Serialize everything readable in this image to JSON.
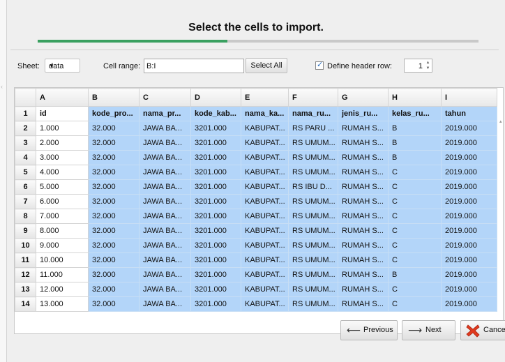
{
  "dialog": {
    "title": "Select the cells to import.",
    "progress": 0.43
  },
  "controls": {
    "sheet_label": "Sheet:",
    "sheet_value": "data",
    "range_label": "Cell range:",
    "range_value": "B:I",
    "select_all_label": "Select All",
    "define_header_label": "Define header row:",
    "define_header_checked": true,
    "header_row_value": "1"
  },
  "grid": {
    "columns": [
      "A",
      "B",
      "C",
      "D",
      "E",
      "F",
      "G",
      "H",
      "I"
    ],
    "rows": [
      {
        "num": "1",
        "cells": [
          "id",
          "kode_pro...",
          "nama_pr...",
          "kode_kab...",
          "nama_ka...",
          "nama_ru...",
          "jenis_ru...",
          "kelas_ru...",
          "tahun"
        ]
      },
      {
        "num": "2",
        "cells": [
          "1.000",
          "32.000",
          "JAWA BA...",
          "3201.000",
          "KABUPAT...",
          "RS PARU ...",
          "RUMAH S...",
          "B",
          "2019.000"
        ]
      },
      {
        "num": "3",
        "cells": [
          "2.000",
          "32.000",
          "JAWA BA...",
          "3201.000",
          "KABUPAT...",
          "RS UMUM...",
          "RUMAH S...",
          "B",
          "2019.000"
        ]
      },
      {
        "num": "4",
        "cells": [
          "3.000",
          "32.000",
          "JAWA BA...",
          "3201.000",
          "KABUPAT...",
          "RS UMUM...",
          "RUMAH S...",
          "B",
          "2019.000"
        ]
      },
      {
        "num": "5",
        "cells": [
          "4.000",
          "32.000",
          "JAWA BA...",
          "3201.000",
          "KABUPAT...",
          "RS UMUM...",
          "RUMAH S...",
          "C",
          "2019.000"
        ]
      },
      {
        "num": "6",
        "cells": [
          "5.000",
          "32.000",
          "JAWA BA...",
          "3201.000",
          "KABUPAT...",
          "RS IBU D...",
          "RUMAH S...",
          "C",
          "2019.000"
        ]
      },
      {
        "num": "7",
        "cells": [
          "6.000",
          "32.000",
          "JAWA BA...",
          "3201.000",
          "KABUPAT...",
          "RS UMUM...",
          "RUMAH S...",
          "C",
          "2019.000"
        ]
      },
      {
        "num": "8",
        "cells": [
          "7.000",
          "32.000",
          "JAWA BA...",
          "3201.000",
          "KABUPAT...",
          "RS UMUM...",
          "RUMAH S...",
          "C",
          "2019.000"
        ]
      },
      {
        "num": "9",
        "cells": [
          "8.000",
          "32.000",
          "JAWA BA...",
          "3201.000",
          "KABUPAT...",
          "RS UMUM...",
          "RUMAH S...",
          "C",
          "2019.000"
        ]
      },
      {
        "num": "10",
        "cells": [
          "9.000",
          "32.000",
          "JAWA BA...",
          "3201.000",
          "KABUPAT...",
          "RS UMUM...",
          "RUMAH S...",
          "C",
          "2019.000"
        ]
      },
      {
        "num": "11",
        "cells": [
          "10.000",
          "32.000",
          "JAWA BA...",
          "3201.000",
          "KABUPAT...",
          "RS UMUM...",
          "RUMAH S...",
          "C",
          "2019.000"
        ]
      },
      {
        "num": "12",
        "cells": [
          "11.000",
          "32.000",
          "JAWA BA...",
          "3201.000",
          "KABUPAT...",
          "RS UMUM...",
          "RUMAH S...",
          "B",
          "2019.000"
        ]
      },
      {
        "num": "13",
        "cells": [
          "12.000",
          "32.000",
          "JAWA BA...",
          "3201.000",
          "KABUPAT...",
          "RS UMUM...",
          "RUMAH S...",
          "C",
          "2019.000"
        ]
      },
      {
        "num": "14",
        "cells": [
          "13.000",
          "32.000",
          "JAWA BA...",
          "3201.000",
          "KABUPAT...",
          "RS UMUM...",
          "RUMAH S...",
          "C",
          "2019.000"
        ]
      }
    ]
  },
  "footer": {
    "previous_label": "Previous",
    "next_label": "Next",
    "cancel_label": "Cancel"
  },
  "icons": {
    "left_arrow": "left-arrow-icon",
    "right_arrow": "right-arrow-icon",
    "cancel": "red-x-icon",
    "dropdown": "triangle-down-icon",
    "check": "checkmark-icon",
    "spinner": "up-down-arrows-icon"
  },
  "colors": {
    "progress_fill": "#3aa060",
    "selection": "#b3d5f9",
    "cancel_x": "#e03a1e"
  }
}
